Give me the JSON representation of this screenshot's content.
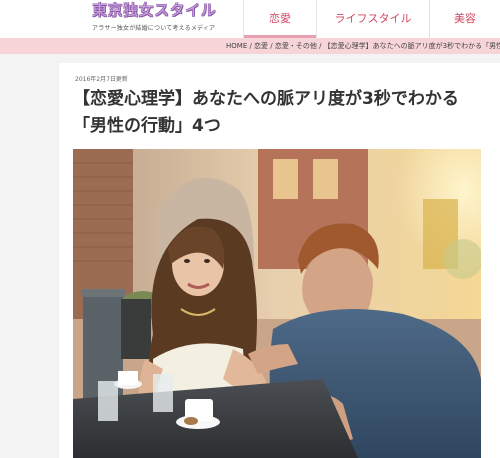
{
  "site": {
    "logo_text": "東京独女スタイル",
    "tagline": "アラサー独女が結婚について考えるメディア"
  },
  "nav": {
    "items": [
      {
        "label": "恋愛",
        "active": true
      },
      {
        "label": "ライフスタイル",
        "active": false
      },
      {
        "label": "美容",
        "active": false
      }
    ]
  },
  "breadcrumb": {
    "text": "HOME / 恋愛 / 恋愛・その他 / 【恋愛心理学】あなたへの脈アリ度が3秒でわかる「男性の行"
  },
  "article": {
    "date": "2016年2月7日更新",
    "title": "【恋愛心理学】あなたへの脈アリ度が3秒でわかる「男性の行動」4つ"
  },
  "colors": {
    "accent": "#d04a62",
    "pinkbar": "#f7d4d8",
    "logo": "#c9a2dc"
  }
}
